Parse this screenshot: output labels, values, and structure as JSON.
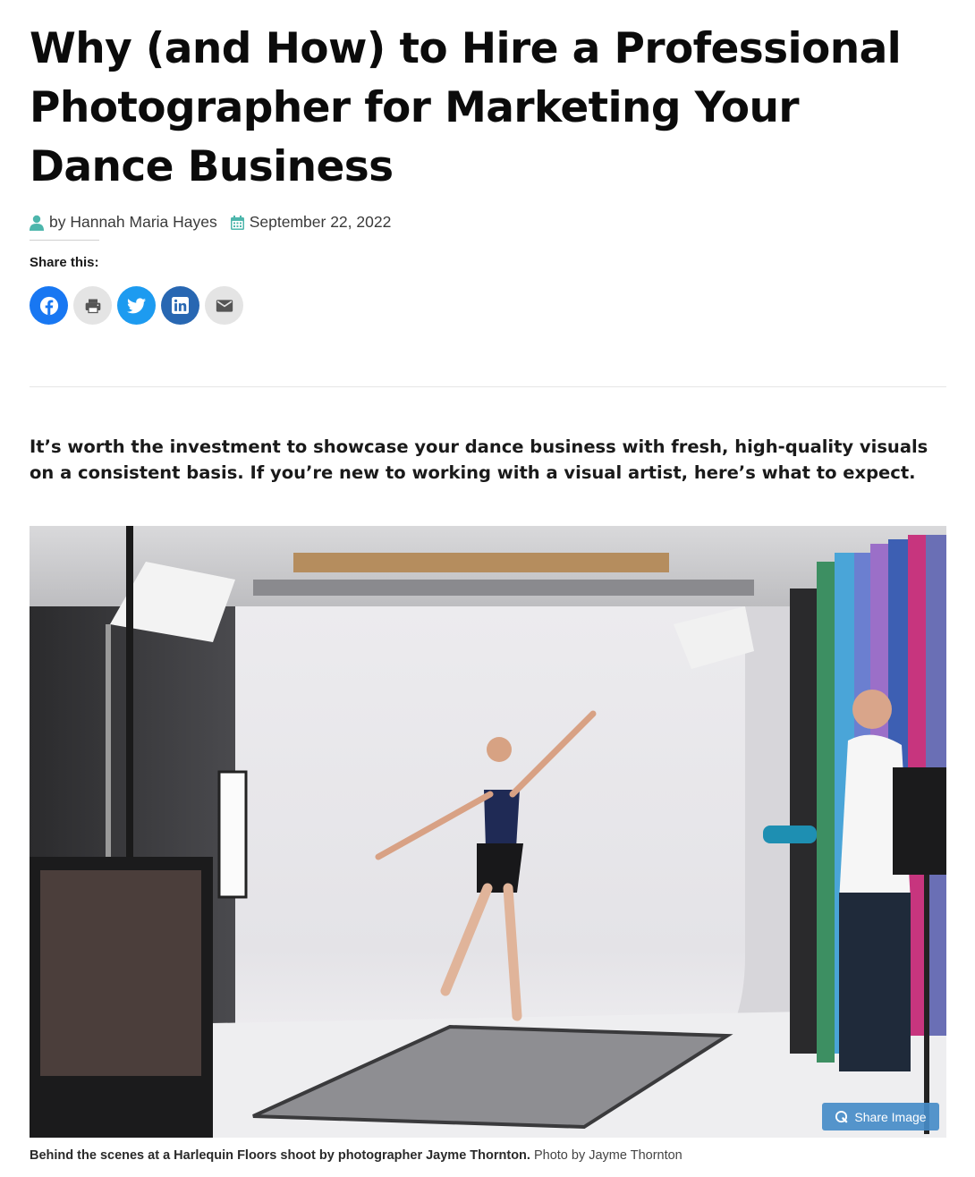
{
  "article": {
    "title": "Why (and How) to Hire a Professional Photographer for Marketing Your Dance Business",
    "author": "by Hannah Maria Hayes",
    "date": "September 22, 2022",
    "intro": "It’s worth the investment to showcase your dance business with fresh, high-quality visuals on a consistent basis. If you’re new to working with a visual artist, here’s what to expect."
  },
  "share": {
    "label": "Share this:",
    "buttons": [
      {
        "name": "facebook",
        "icon": "facebook-icon",
        "color": "#1877f2"
      },
      {
        "name": "print",
        "icon": "printer-icon",
        "color": "#e4e4e4"
      },
      {
        "name": "twitter",
        "icon": "twitter-icon",
        "color": "#1d9bf0"
      },
      {
        "name": "linkedin",
        "icon": "linkedin-icon",
        "color": "#2867b2"
      },
      {
        "name": "email",
        "icon": "envelope-icon",
        "color": "#e4e4e4"
      }
    ]
  },
  "figure": {
    "share_image_label": "Share Image",
    "caption_bold": "Behind the scenes at a Harlequin Floors shoot by photographer Jayme Thornton.",
    "caption_credit": "Photo by Jayme Thornton"
  },
  "colors": {
    "meta_icon": "#4db6ac",
    "text": "#111111"
  }
}
